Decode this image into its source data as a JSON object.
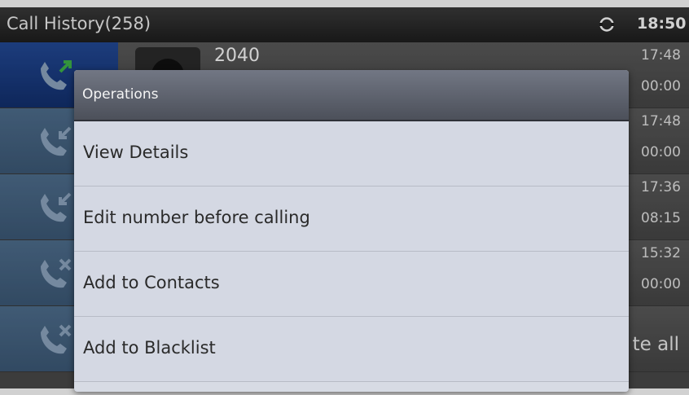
{
  "statusbar": {
    "title": "Call History(258)",
    "time": "18:50",
    "sync_icon": "sync-icon"
  },
  "call_list": [
    {
      "name": "2040",
      "time1": "17:48",
      "time2": "00:00",
      "type_icon": "outgoing-call-icon",
      "selected": true
    },
    {
      "name": "",
      "time1": "17:48",
      "time2": "00:00",
      "type_icon": "incoming-call-icon",
      "selected": false
    },
    {
      "name": "",
      "time1": "17:36",
      "time2": "08:15",
      "type_icon": "incoming-call-icon",
      "selected": false
    },
    {
      "name": "",
      "time1": "15:32",
      "time2": "00:00",
      "type_icon": "missed-call-icon",
      "selected": false
    }
  ],
  "list_footer": {
    "delete_all_label": "te all"
  },
  "operations_dialog": {
    "title": "Operations",
    "items": [
      {
        "label": "View Details"
      },
      {
        "label": "Edit number before calling"
      },
      {
        "label": "Add to Contacts"
      },
      {
        "label": "Add to Blacklist"
      }
    ]
  },
  "colors": {
    "selected_row": "#1a3c86",
    "dialog_header": "#5d616c",
    "dialog_body": "#d4d8e3"
  }
}
